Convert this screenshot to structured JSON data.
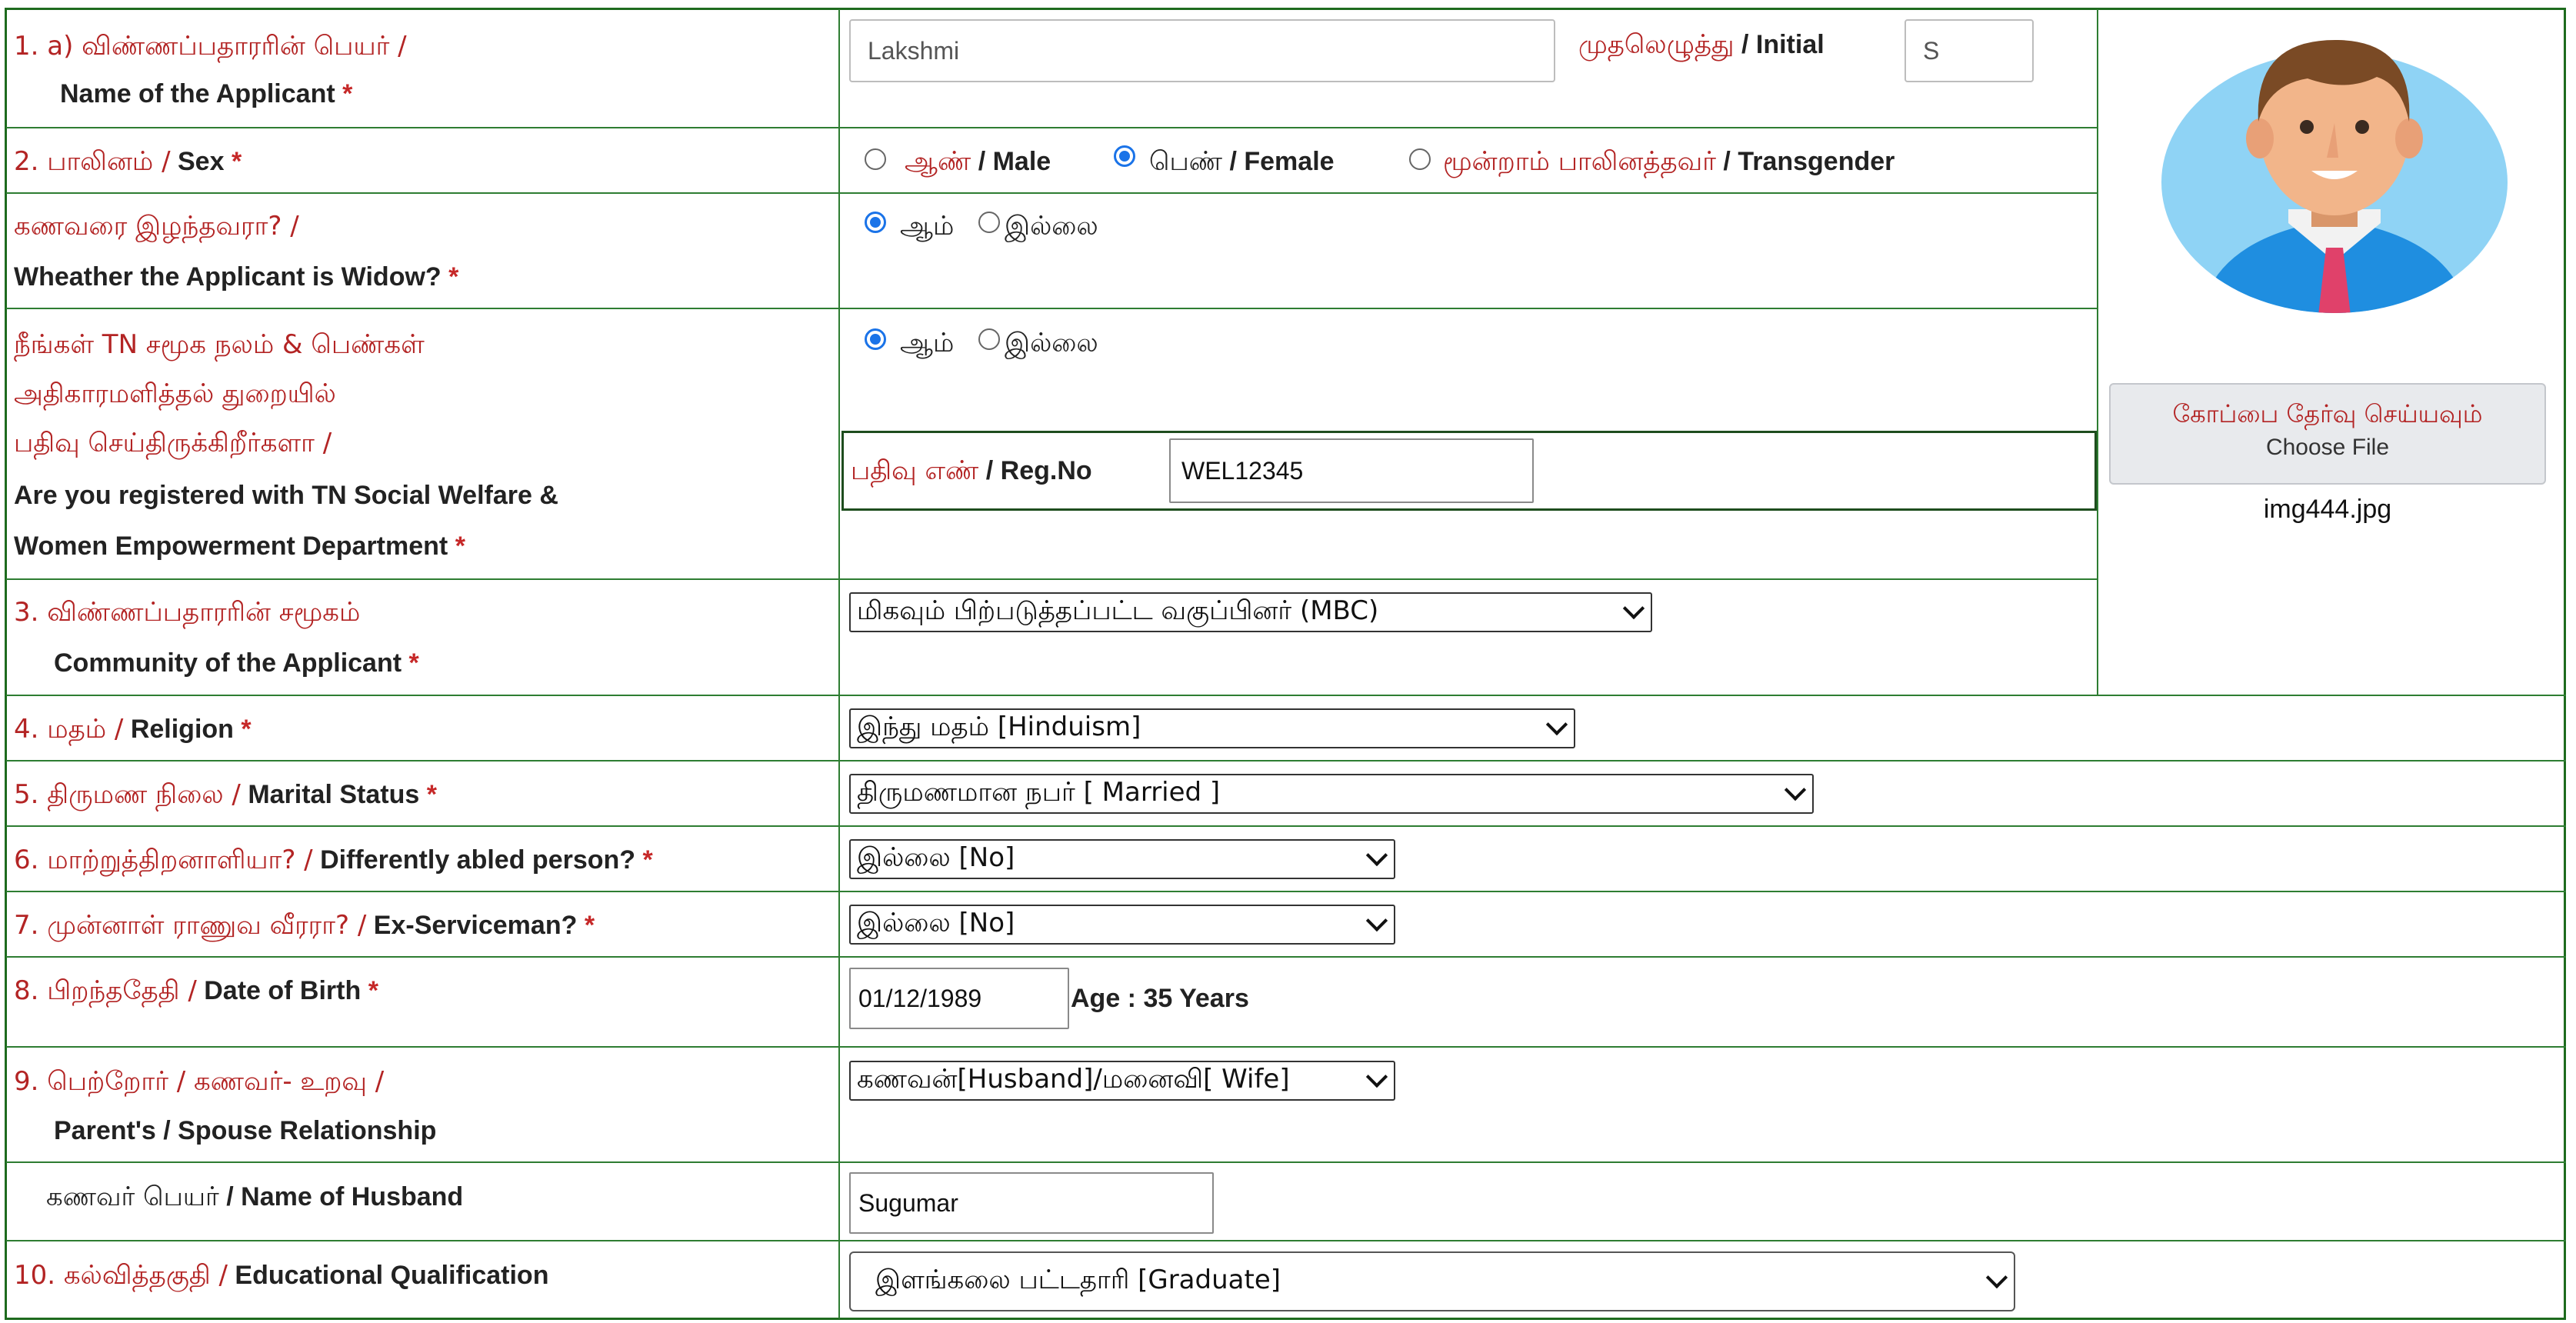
{
  "form": {
    "name": {
      "label_ta": "1. a) விண்ணப்பதாரரின் பெயர் /",
      "label_en": "Name of the Applicant",
      "value": "Lakshmi",
      "initial_label_ta": "முதலெழுத்து",
      "initial_label_en": "/ Initial",
      "initial_value": "S"
    },
    "sex": {
      "label_ta": "2. பாலினம் /",
      "label_en": "Sex",
      "options": [
        {
          "ta": "ஆண்",
          "en": "/ Male",
          "selected": false
        },
        {
          "ta": "பெண்",
          "en": "/ Female",
          "selected": true
        },
        {
          "ta": "மூன்றாம் பாலினத்தவர்",
          "en": "/ Transgender",
          "selected": false
        }
      ]
    },
    "widow": {
      "label_ta": "கணவரை இழந்தவரா? /",
      "label_en": "Wheather the Applicant is Widow?",
      "yes": "ஆம்",
      "no": "இல்லை",
      "selected": "yes"
    },
    "registered": {
      "label_ta_1": "நீங்கள் TN சமூக நலம் & பெண்கள்",
      "label_ta_2": "அதிகாரமளித்தல் துறையில்",
      "label_ta_3": "பதிவு செய்திருக்கிறீர்களா /",
      "label_en_1": "Are you registered with TN Social Welfare &",
      "label_en_2": "Women Empowerment Department",
      "yes": "ஆம்",
      "no": "இல்லை",
      "selected": "yes",
      "reg_label_ta": "பதிவு எண்",
      "reg_label_en": "/ Reg.No",
      "reg_value": "WEL12345"
    },
    "community": {
      "label_ta": "3. விண்ணப்பதாரரின் சமூகம்",
      "label_en": "Community of the Applicant",
      "value": "மிகவும் பிற்படுத்தப்பட்ட வகுப்பினர் (MBC)"
    },
    "religion": {
      "label_ta": "4. மதம் /",
      "label_en": "Religion",
      "value": "இந்து மதம் [Hinduism]"
    },
    "marital": {
      "label_ta": "5. திருமண நிலை /",
      "label_en": "Marital Status",
      "value": "திருமணமான நபர் [ Married ]"
    },
    "disabled": {
      "label_ta": "6. மாற்றுத்திறனாளியா? /",
      "label_en": "Differently abled person?",
      "value": "இல்லை [No]"
    },
    "exservice": {
      "label_ta": "7. முன்னாள் ராணுவ வீரரா? /",
      "label_en": "Ex-Serviceman?",
      "value": "இல்லை [No]"
    },
    "dob": {
      "label_ta": "8. பிறந்ததேதி /",
      "label_en": "Date of Birth",
      "value": "01/12/1989",
      "age_text": "Age : 35 Years"
    },
    "relationship": {
      "label_ta": "9. பெற்றோர் / கணவர்- உறவு /",
      "label_en": "Parent's / Spouse Relationship",
      "value": "கணவன்[Husband]/மனைவி[ Wife]"
    },
    "husband": {
      "label_ta": "கணவர் பெயர்",
      "label_en": "/ Name of Husband",
      "value": "Sugumar"
    },
    "education": {
      "label_ta": "10. கல்வித்தகுதி /",
      "label_en": "Educational Qualification",
      "value": "இளங்கலை பட்டதாரி [Graduate]"
    }
  },
  "photo": {
    "button_ta": "கோப்பை தேர்வு செய்யவும்",
    "button_en": "Choose File",
    "filename": "img444.jpg"
  },
  "required_mark": "*",
  "colors": {
    "border": "#2e7d32",
    "tamil_label": "#b32424",
    "radio_selected": "#1a73e8"
  }
}
